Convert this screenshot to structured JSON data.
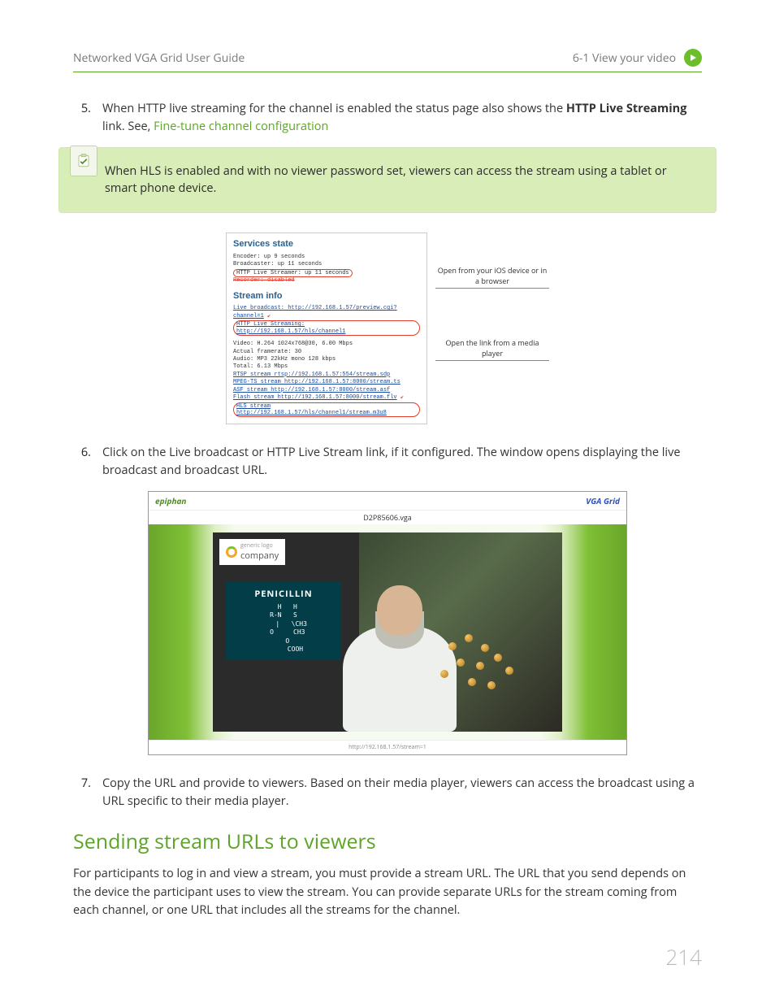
{
  "header": {
    "left": "Networked VGA Grid User Guide",
    "right": "6-1  View your video"
  },
  "steps": {
    "s5_num": "5.",
    "s5_text_a": "When HTTP live streaming for the channel is enabled the status page also shows the ",
    "s5_bold": "HTTP Live Streaming",
    "s5_text_b": " link. See, ",
    "s5_link": "Fine-tune channel configuration",
    "s6_num": "6.",
    "s6_text": "Click on the Live broadcast or HTTP Live Stream link, if it configured. The window opens displaying the live broadcast and broadcast URL.",
    "s7_num": "7.",
    "s7_text": "Copy the URL and provide to viewers. Based on their media player, viewers can access the broadcast using a URL specific to their media player."
  },
  "note": "When HLS is enabled and with no viewer password set, viewers can access the stream using a tablet or smart phone device.",
  "services": {
    "title1": "Services state",
    "encoder": "Encoder: up 9 seconds",
    "broad": "Broadcaster: up 11 seconds",
    "hls_up": "HTTP Live Streamer: up 11 seconds",
    "rec": "Recorder: disabled",
    "title2": "Stream info",
    "live": "Live broadcast: http://192.168.1.57/preview.cgi?channel=1",
    "hls_link": "HTTP Live Streaming: http://192.168.1.57/hls/channel1",
    "video": "Video: H.264 1024x768@30, 6.00 Mbps",
    "af": "Actual framerate: 30",
    "audio": "Audio: MP3 22kHz mono 128 kbps",
    "total": "Total: 6.13 Mbps",
    "rtsp": "RTSP stream rtsp://192.168.1.57:554/stream.sdp",
    "mpegts": "MPEG-TS stream http://192.168.1.57:8000/stream.ts",
    "asf": "ASF stream http://192.168.1.57:8000/stream.asf",
    "flash": "Flash stream http://192.168.1.57:8000/stream.flv",
    "hls2": "HLS stream http://192.168.1.57/hls/channel1/stream.m3u8"
  },
  "annotations": {
    "ios": "Open from your iOS device or in a browser",
    "media": "Open the link from a media player"
  },
  "player": {
    "brand_left": "epiphan",
    "brand_right": "VGA Grid",
    "filename": "D2P85606.vga",
    "logo_top": "generic logo",
    "logo_company": "company",
    "chalk_title": "PENICILLIN",
    "chalk_struct": "  H   H\nR-N   S\n    |   \\CH3\n  O     CH3\n     O   \n      COOH",
    "footer": "http://192.168.1.57/stream=1"
  },
  "section": {
    "h2": "Sending stream URLs to viewers",
    "para": "For participants to log in and view a stream, you must provide a stream URL. The URL that you send depends on the device the participant uses to view the stream. You can provide separate URLs for the stream coming from each channel, or one URL that includes all the streams for the channel."
  },
  "page_number": "214"
}
